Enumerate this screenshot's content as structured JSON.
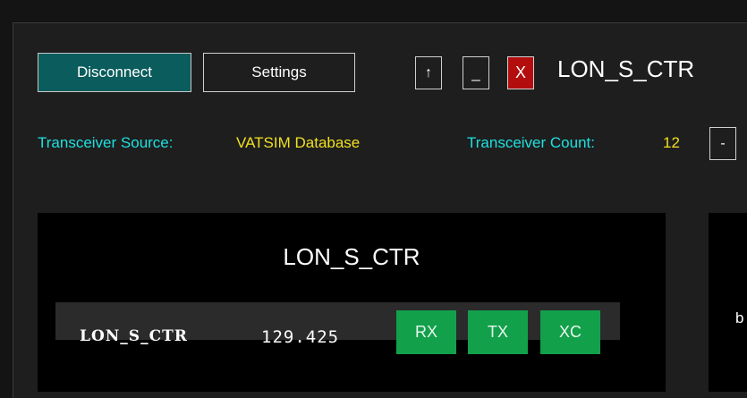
{
  "window": {
    "title": "LON_S_CTR"
  },
  "toolbar": {
    "disconnect_label": "Disconnect",
    "settings_label": "Settings",
    "up_label": "↑",
    "minimize_label": "_",
    "close_label": "X"
  },
  "info": {
    "source_label": "Transceiver Source:",
    "source_value": "VATSIM Database",
    "count_label": "Transceiver Count:",
    "count_value": "12",
    "dash_label": "-"
  },
  "station": {
    "title": "LON_S_CTR",
    "callsign": "LON_S_CTR",
    "frequency": "129.425",
    "rx_label": "RX",
    "tx_label": "TX",
    "xc_label": "XC"
  },
  "side_panel": {
    "text": "b"
  },
  "colors": {
    "background": "#1e1e1e",
    "disconnect_bg": "#0b5c5c",
    "close_bg": "#b30d0d",
    "label_cyan": "#1ee0e0",
    "value_yellow": "#f0e020",
    "pill_green": "#12a04a",
    "row_bg": "#2b2b2b"
  }
}
